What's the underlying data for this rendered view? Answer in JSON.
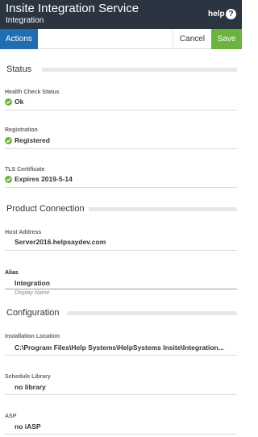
{
  "header": {
    "title": "Insite Integration Service",
    "subtitle": "Integration",
    "help_label": "help",
    "help_icon": "question-circle-icon"
  },
  "toolbar": {
    "actions_label": "Actions",
    "cancel_label": "Cancel",
    "save_label": "Save"
  },
  "colors": {
    "header_bg": "#2b3441",
    "actions_bg": "#1f6db3",
    "save_bg": "#6bb33f",
    "status_ok": "#6bb33f"
  },
  "status": {
    "title": "Status",
    "health": {
      "label": "Health Check Status",
      "value": "Ok",
      "icon": "check-circle-icon"
    },
    "registration": {
      "label": "Registration",
      "value": "Registered",
      "icon": "check-circle-icon"
    },
    "tls": {
      "label": "TLS Certificate",
      "value": "Expires 2019-5-14",
      "icon": "check-circle-icon"
    }
  },
  "product_connection": {
    "title": "Product Connection",
    "host": {
      "label": "Host Address",
      "value": "Server2016.helpsaydev.com"
    },
    "alias": {
      "label": "Alias",
      "value": "Integration",
      "hint": "Display Name"
    }
  },
  "configuration": {
    "title": "Configuration",
    "install_location": {
      "label": "Installation Location",
      "value": "C:\\Program Files\\Help Systems\\HelpSystems Insite\\Integration..."
    },
    "schedule_library": {
      "label": "Schedule Library",
      "value": "no library"
    },
    "asp": {
      "label": "ASP",
      "value": "no iASP"
    }
  }
}
